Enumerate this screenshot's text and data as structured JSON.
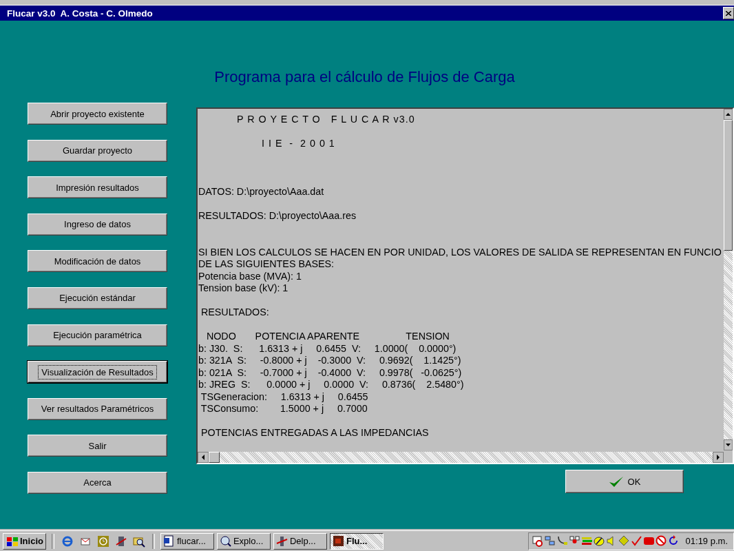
{
  "window": {
    "title": "Flucar v3.0  A. Costa - C. Olmedo"
  },
  "heading": "Programa para el cálculo de Flujos de Carga",
  "menu_buttons": [
    {
      "label": "Abrir proyecto existente",
      "focused": false
    },
    {
      "label": "Guardar proyecto",
      "focused": false
    },
    {
      "label": "Impresión resultados",
      "focused": false
    },
    {
      "label": "Ingreso de datos",
      "focused": false
    },
    {
      "label": "Modificación de datos",
      "focused": false
    },
    {
      "label": "Ejecución estándar",
      "focused": false
    },
    {
      "label": "Ejecución paramétrica",
      "focused": false
    },
    {
      "label": "Visualización de Resultados",
      "focused": true
    },
    {
      "label": "Ver resultados Paramétricos",
      "focused": false
    },
    {
      "label": "Salir",
      "focused": false
    },
    {
      "label": "Acerca",
      "focused": false
    }
  ],
  "report": {
    "lines": [
      {
        "kind": "title",
        "text": "P R O Y E C T O   F L U C A R v3.0"
      },
      {
        "kind": "blank"
      },
      {
        "kind": "subtitle",
        "text": "I I E  -  2 0 0 1"
      },
      {
        "kind": "blank"
      },
      {
        "kind": "blank"
      },
      {
        "kind": "blank"
      },
      {
        "kind": "text",
        "text": "DATOS: D:\\proyecto\\Aaa.dat"
      },
      {
        "kind": "blank"
      },
      {
        "kind": "text",
        "text": "RESULTADOS: D:\\proyecto\\Aaa.res"
      },
      {
        "kind": "blank"
      },
      {
        "kind": "blank"
      },
      {
        "kind": "text",
        "text": "SI BIEN LOS CALCULOS SE HACEN EN POR UNIDAD, LOS VALORES DE SALIDA SE REPRESENTAN EN FUNCIO"
      },
      {
        "kind": "text",
        "text": "DE LAS SIGUIENTES BASES:"
      },
      {
        "kind": "text",
        "text": "Potencia base (MVA): 1"
      },
      {
        "kind": "text",
        "text": "Tension base (kV): 1"
      },
      {
        "kind": "blank"
      },
      {
        "kind": "text",
        "text": " RESULTADOS:"
      },
      {
        "kind": "blank"
      },
      {
        "kind": "text",
        "text": "   NODO       POTENCIA APARENTE                 TENSION"
      },
      {
        "kind": "text",
        "text": "b: J30.  S:      1.6313 + j     0.6455  V:     1.0000(    0.0000°)"
      },
      {
        "kind": "text",
        "text": "b: 321A  S:     -0.8000 + j    -0.3000  V:     0.9692(    1.1425°)"
      },
      {
        "kind": "text",
        "text": "b: 021A  S:     -0.7000 + j    -0.4000  V:     0.9978(   -0.0625°)"
      },
      {
        "kind": "text",
        "text": "b: JREG  S:      0.0000 + j     0.0000  V:     0.8736(    2.5480°)"
      },
      {
        "kind": "text",
        "text": " TSGeneracion:     1.6313 + j     0.6455"
      },
      {
        "kind": "text",
        "text": " TSConsumo:        1.5000 + j     0.7000"
      },
      {
        "kind": "blank"
      },
      {
        "kind": "text",
        "text": " POTENCIAS ENTREGADAS A LAS IMPEDANCIAS"
      }
    ]
  },
  "ok_button": {
    "label": "OK"
  },
  "taskbar": {
    "start": "Inicio",
    "tasks": [
      {
        "label": "flucar...",
        "selected": false
      },
      {
        "label": "Explo...",
        "selected": false
      },
      {
        "label": "Delp...",
        "selected": false
      },
      {
        "label": "Flu...",
        "selected": true
      }
    ],
    "clock": "01:19 p.m."
  }
}
